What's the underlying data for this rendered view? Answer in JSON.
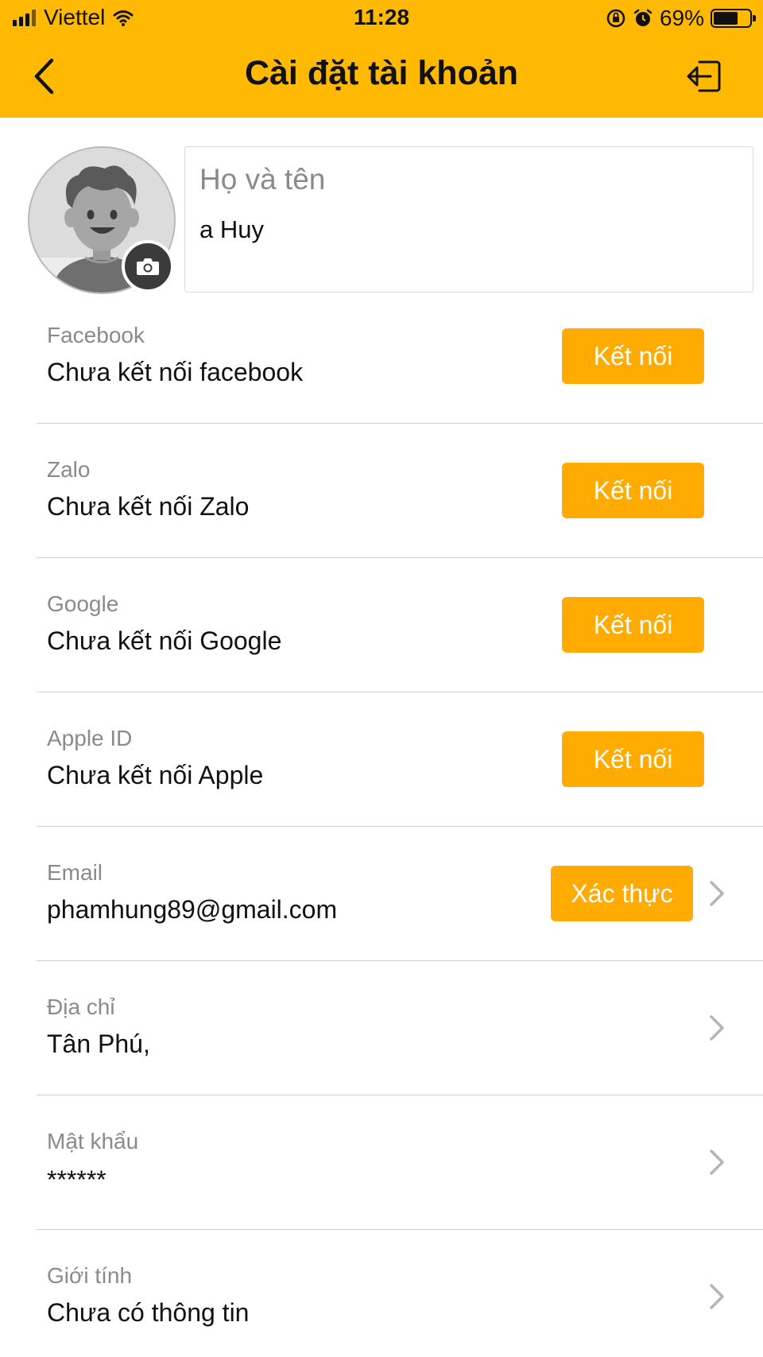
{
  "status_bar": {
    "carrier": "Viettel",
    "time": "11:28",
    "battery": "69%",
    "battery_level": 0.69
  },
  "header": {
    "title": "Cài đặt tài khoản",
    "back_icon": "chevron-left-icon",
    "logout_icon": "logout-icon"
  },
  "profile": {
    "name_label": "Họ và tên",
    "name_value": "a Huy",
    "avatar_icon": "default-avatar",
    "camera_icon": "camera-icon"
  },
  "rows": [
    {
      "label": "Facebook",
      "value": "Chưa kết nối facebook",
      "button": "Kết nối"
    },
    {
      "label": "Zalo",
      "value": "Chưa kết nối Zalo",
      "button": "Kết nối"
    },
    {
      "label": "Google",
      "value": "Chưa kết nối Google",
      "button": "Kết nối"
    },
    {
      "label": "Apple ID",
      "value": "Chưa kết nối Apple",
      "button": "Kết nối"
    },
    {
      "label": "Email",
      "value": "phamhung89@gmail.com",
      "button": "Xác thực"
    },
    {
      "label": "Địa chỉ",
      "value": "Tân Phú,"
    },
    {
      "label": "Mật khẩu",
      "value": "******"
    },
    {
      "label": "Giới tính",
      "value": "Chưa có thông tin"
    }
  ],
  "colors": {
    "header_bg": "#FFB902",
    "button_bg": "#FFAB02",
    "label_gray": "#8A8A8A"
  }
}
